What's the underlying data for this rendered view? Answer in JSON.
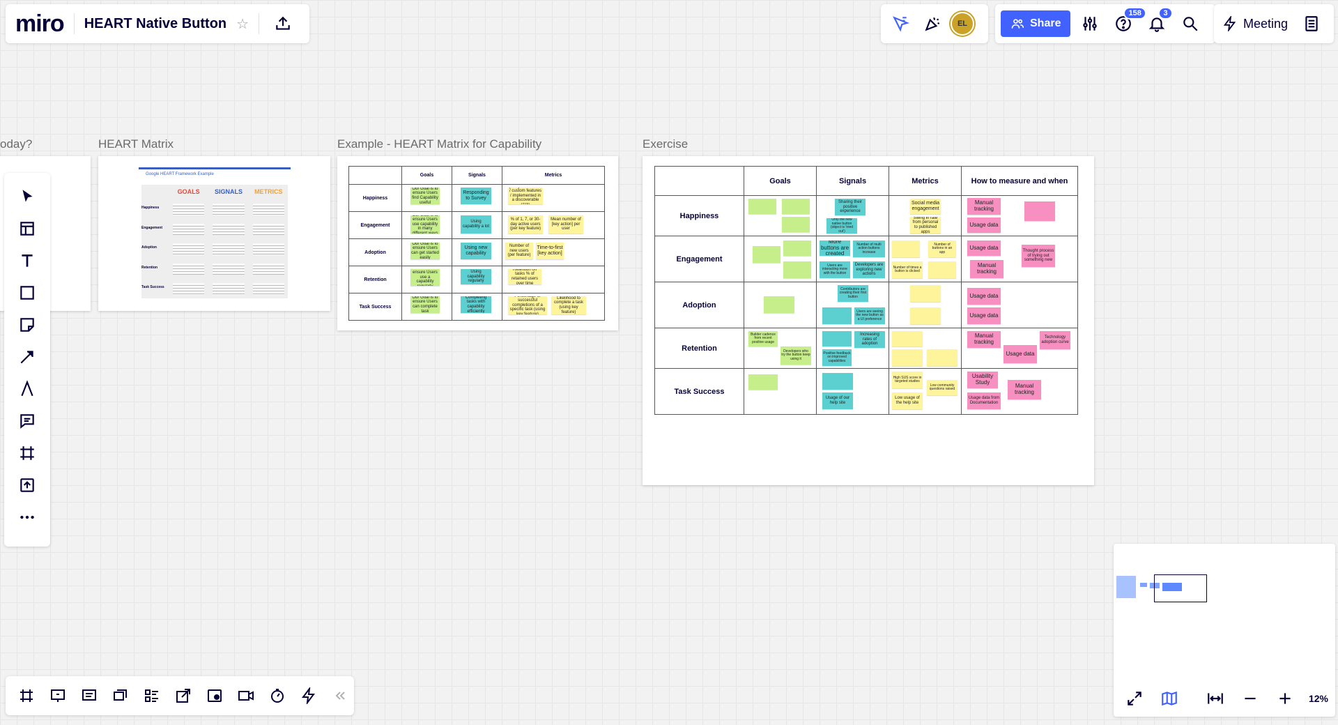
{
  "header": {
    "logo": "miro",
    "board_title": "HEART Native Button",
    "star_icon": "star-icon",
    "upload_icon": "upload-icon",
    "avatar_initials": "EL",
    "share_label": "Share",
    "help_badge": "158",
    "notif_badge": "3",
    "meeting_label": "Meeting"
  },
  "frames": {
    "left_partial_label": "oday?",
    "heart_matrix_label": "HEART Matrix",
    "capability_label": "Example - HEART Matrix for Capability",
    "exercise_label": "Exercise"
  },
  "google_example": {
    "title": "Google HEART Framework Example",
    "cols": [
      "GOALS",
      "SIGNALS",
      "METRICS"
    ],
    "rows": [
      "Happiness",
      "Engagement",
      "Adoption",
      "Retention",
      "Task Success"
    ]
  },
  "capability_table": {
    "headers": [
      "",
      "Goals",
      "Signals",
      "Metrics"
    ],
    "rows": [
      {
        "label": "Happiness",
        "goal": "Our Goal is to ensure Users find Capability useful",
        "signal": "Responding to Survey",
        "metric": "pretty can be use / custom features / implemented in a discoverable state"
      },
      {
        "label": "Engagement",
        "goal": "Our Goal is to ensure Users use capability in many different ways",
        "signal": "Using capability a lot",
        "metric1": "% of 1, 7, or 30-day active users (per key feature)",
        "metric2": "Mean number of [key action] per user"
      },
      {
        "label": "Adoption",
        "goal": "Our Goal is to ensure Users can get started easily",
        "signal": "Using new capability",
        "metric1": "Number of new users (per feature)",
        "metric2": "Time-to-first [key action]"
      },
      {
        "label": "Retention",
        "goal": "Our Goal is to ensure Users use a capability regularly",
        "signal": "Using capability regularly",
        "metric": "Retention on tasks % of retained users over time"
      },
      {
        "label": "Task Success",
        "goal": "Our Goal is to ensure Users can complete task",
        "signal": "Completing tasks with capability efficiently",
        "metric1": "Percentage of successful completions of a specific task (using key feature)",
        "metric2": "Likelihood to complete a task (using key feature)"
      }
    ]
  },
  "exercise_table": {
    "headers": [
      "",
      "Goals",
      "Signals",
      "Metrics",
      "How to measure and when"
    ],
    "rows": [
      {
        "label": "Happiness",
        "signal": "Sharing their positive experience",
        "signal2": "Only the new native button (object is 'tried out')",
        "metric": "Social media engagement",
        "metric2": "Swing in rate from personal to published apps",
        "m1": "Manual tracking",
        "m2": "Usage data"
      },
      {
        "label": "Engagement",
        "signal": "More buttons are created",
        "signal2": "Number of multi action buttons increase",
        "signal3": "Users are interacting more with the button",
        "signal4": "Developers are exploring new actions",
        "metric": "Number of buttons in an app",
        "metric2": "Number of times a button is clicked",
        "m1": "Usage data",
        "m2": "Manual tracking",
        "m3": "Thought process of trying out something new"
      },
      {
        "label": "Adoption",
        "signal": "Contributors are creating their first button",
        "signal2": "Users are seeing the new button as a UI preference",
        "m1": "Usage data",
        "m2": "Usage data"
      },
      {
        "label": "Retention",
        "goal": "Builder cadence from recent positive usage",
        "goal2": "Developers who try the button keep using it",
        "signal": "Increasing rates of adoption",
        "signal2": "Positive feedback on improved capabilities",
        "m1": "Manual tracking",
        "m2": "Usage data",
        "m3": "Technology adoption curve"
      },
      {
        "label": "Task Success",
        "signal": "Usage of our help site",
        "metric": "High SUS score in targeted studies",
        "metric2": "Low community questions raised",
        "metric3": "Low usage of the help site",
        "m1": "Usability Study",
        "m2": "Usage data from Documentation",
        "m3": "Manual tracking"
      }
    ]
  },
  "right_toolbar": {
    "zoom": "12%"
  },
  "colors": {
    "accent": "#4262ff",
    "sticky_green": "#c6ef8b",
    "sticky_blue": "#5ccfd0",
    "sticky_yellow": "#fdf49c",
    "sticky_pink": "#f78fc0"
  }
}
